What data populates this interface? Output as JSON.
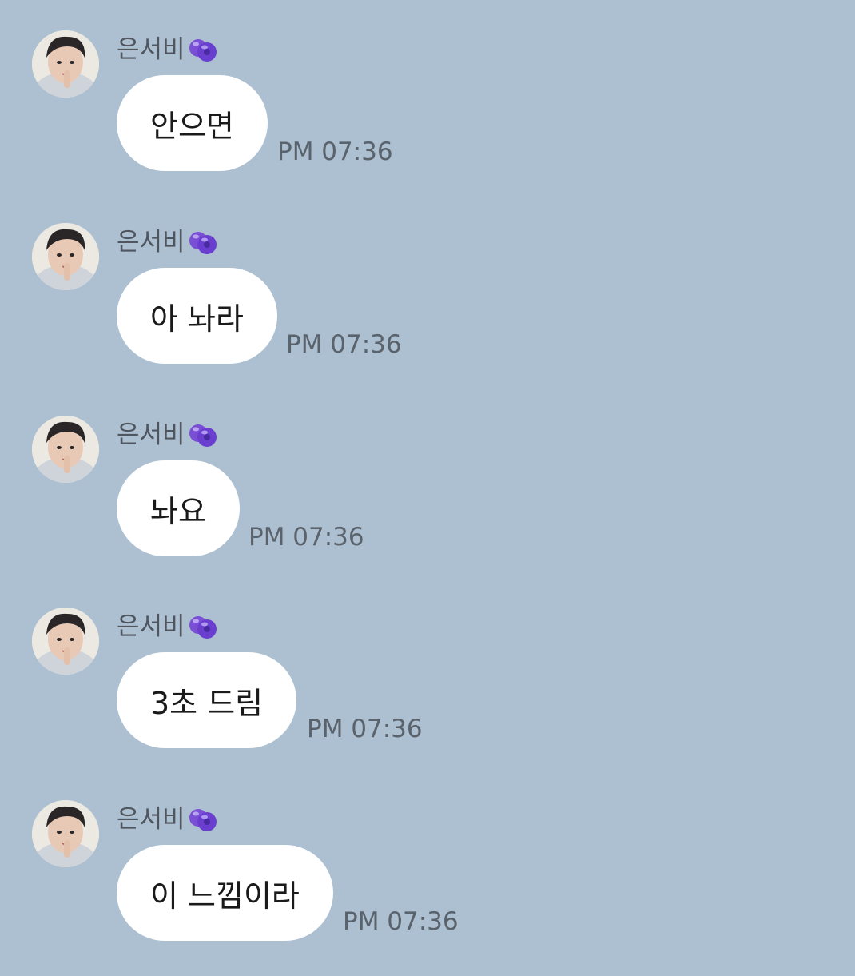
{
  "chat": {
    "messages": [
      {
        "sender": "은서비",
        "badge_icon": "blueberry-icon",
        "text": "안으면",
        "time": "PM 07:36"
      },
      {
        "sender": "은서비",
        "badge_icon": "blueberry-icon",
        "text": "아 놔라",
        "time": "PM 07:36"
      },
      {
        "sender": "은서비",
        "badge_icon": "blueberry-icon",
        "text": "놔요",
        "time": "PM 07:36"
      },
      {
        "sender": "은서비",
        "badge_icon": "blueberry-icon",
        "text": "3초 드림",
        "time": "PM 07:36"
      },
      {
        "sender": "은서비",
        "badge_icon": "blueberry-icon",
        "text": "이 느낌이라",
        "time": "PM 07:36"
      }
    ]
  },
  "colors": {
    "background": "#adc0d1",
    "bubble": "#ffffff",
    "text": "#1a1a1a",
    "meta_text": "#5a626b",
    "badge": "#7a4fd6"
  }
}
